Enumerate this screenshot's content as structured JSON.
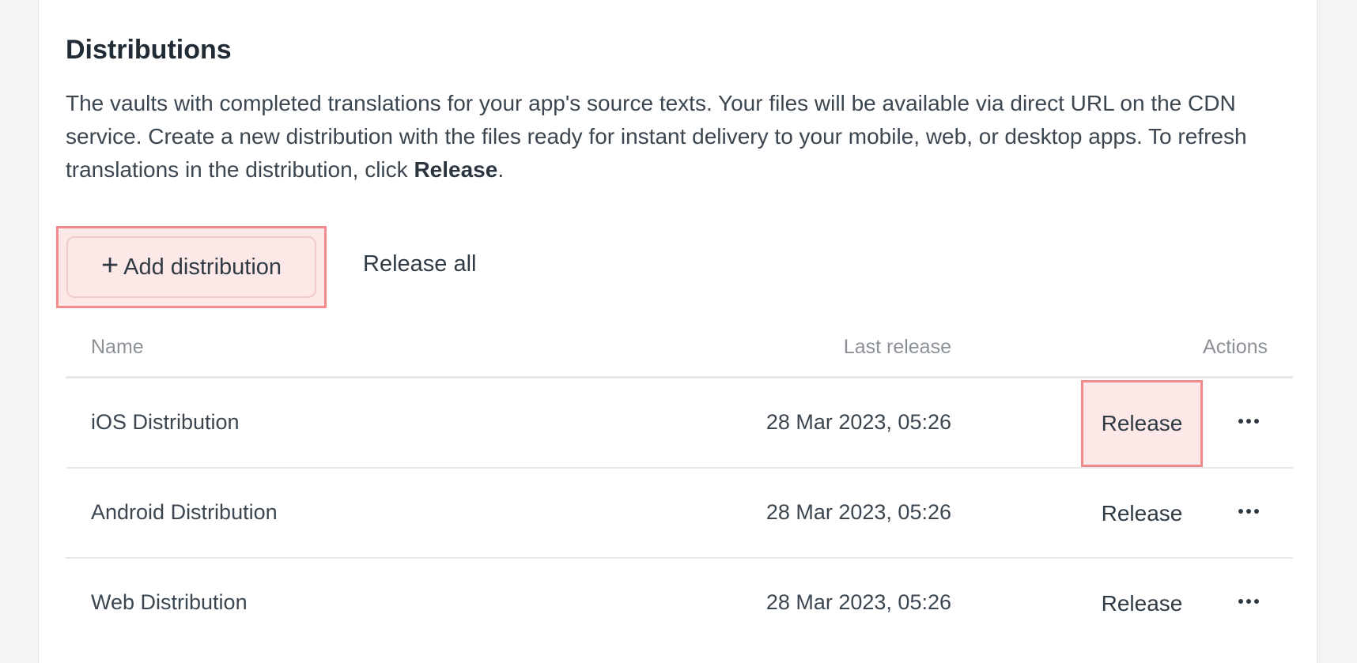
{
  "section": {
    "title": "Distributions",
    "description_prefix": "The vaults with completed translations for your app's source texts. Your files will be available via direct URL on the CDN service. Create a new distribution with the files ready for instant delivery to your mobile, web, or desktop apps. To refresh translations in the distribution, click ",
    "description_bold": "Release",
    "description_suffix": "."
  },
  "toolbar": {
    "add_label": "Add distribution",
    "release_all_label": "Release all"
  },
  "table": {
    "headers": {
      "name": "Name",
      "last_release": "Last release",
      "actions": "Actions"
    },
    "rows": [
      {
        "name": "iOS Distribution",
        "last_release": "28 Mar 2023, 05:26",
        "release_label": "Release"
      },
      {
        "name": "Android Distribution",
        "last_release": "28 Mar 2023, 05:26",
        "release_label": "Release"
      },
      {
        "name": "Web Distribution",
        "last_release": "28 Mar 2023, 05:26",
        "release_label": "Release"
      }
    ]
  },
  "colors": {
    "highlight_border": "#f28a8e",
    "highlight_fill": "#fde8e8",
    "text": "#2f3a44"
  },
  "icons": {
    "add": "plus-icon",
    "more": "more-horizontal-icon"
  }
}
